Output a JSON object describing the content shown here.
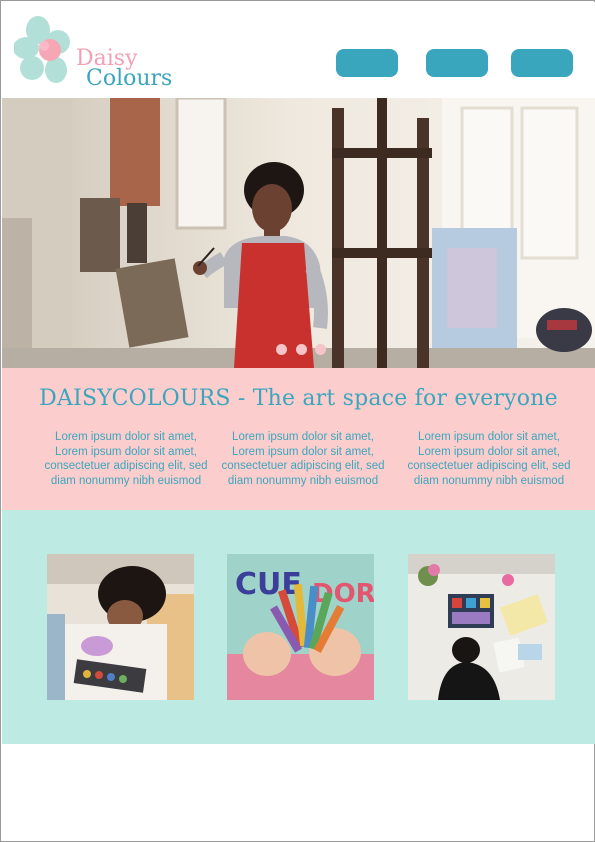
{
  "brand": {
    "name_line1": "Daisy",
    "name_line2": "Colours",
    "colors": {
      "pink": "#f2a0b3",
      "teal": "#3aa6bd",
      "mint": "#b2e0d8"
    }
  },
  "nav": {
    "buttons": [
      {
        "label": ""
      },
      {
        "label": ""
      },
      {
        "label": ""
      }
    ]
  },
  "hero": {
    "icon": "artist-painting-photo",
    "carousel": {
      "slide_count": 3
    }
  },
  "intro": {
    "title": "DAISYCOLOURS - The art space for everyone",
    "columns": [
      {
        "text": "Lorem ipsum dolor sit amet, Lorem ipsum dolor sit amet, consectetuer adipiscing elit, sed diam nonummy nibh euismod"
      },
      {
        "text": "Lorem ipsum dolor sit amet, Lorem ipsum dolor sit amet, consectetuer adipiscing elit, sed diam nonummy nibh euismod"
      },
      {
        "text": "Lorem ipsum dolor sit amet, Lorem ipsum dolor sit amet, consectetuer adipiscing elit, sed diam nonummy nibh euismod"
      }
    ]
  },
  "gallery": {
    "images": [
      {
        "icon": "child-painting-photo"
      },
      {
        "icon": "crayons-in-hands-photo"
      },
      {
        "icon": "artist-desk-overhead-photo"
      }
    ]
  },
  "colors": {
    "intro_bg": "#fccdcd",
    "gallery_bg": "#bdeae3",
    "button": "#3aa6bd",
    "dot": "#f5c4c8"
  }
}
